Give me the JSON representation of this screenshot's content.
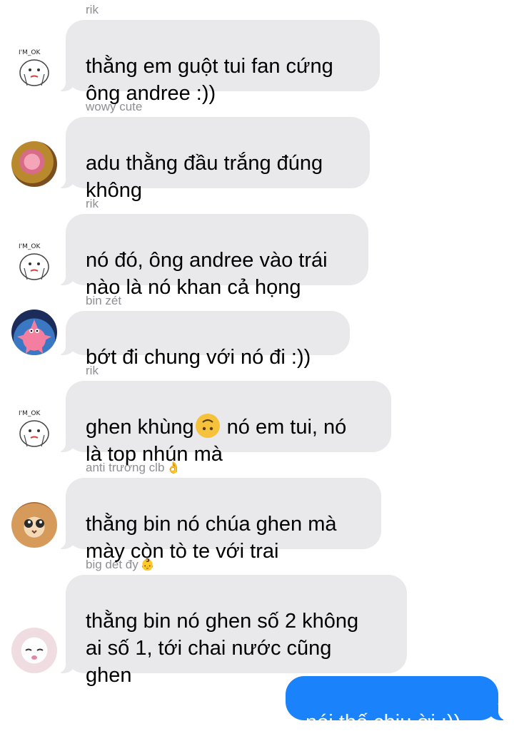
{
  "messages": [
    {
      "sender": "rik",
      "sender_emoji": "",
      "text": "thằng em guột tui fan cứng\nông andree :))",
      "avatar": "sketch-avatar"
    },
    {
      "sender": "wowy cute",
      "sender_emoji": "",
      "text": "adu thằng đầu trắng đúng\nkhông",
      "avatar": "girl-avatar"
    },
    {
      "sender": "rik",
      "sender_emoji": "",
      "text": "nó đó, ông andree vào trái\nnào là nó khan cả họng",
      "avatar": "sketch-avatar"
    },
    {
      "sender": "bin zét",
      "sender_emoji": "",
      "text": "bớt đi chung với nó đi :))",
      "avatar": "patrick-avatar"
    },
    {
      "sender": "rik",
      "sender_emoji": "",
      "text_before_emoji": "ghen khùng",
      "inline_emoji": "upside-down-face",
      "text_after_emoji": " nó em tui, nó\nlà top nhún mà",
      "avatar": "sketch-avatar"
    },
    {
      "sender": "anti trường clb",
      "sender_emoji": "👌",
      "text": "thằng bin nó chúa ghen mà\nmày còn tò te với trai",
      "avatar": "cat-avatar"
    },
    {
      "sender": "big dét đy",
      "sender_emoji": "👶",
      "text": "thằng bin nó ghen số 2 không\nai số 1, tới chai nước cũng\nghen",
      "avatar": "white-cat-avatar"
    }
  ],
  "outgoing": {
    "text": "nói thế chịu ời :))"
  },
  "sketch_label": "I'M_OK",
  "colors": {
    "incoming_bubble": "#e9e9eb",
    "outgoing_bubble": "#1a82fb",
    "sender_name": "#8e8e93"
  }
}
